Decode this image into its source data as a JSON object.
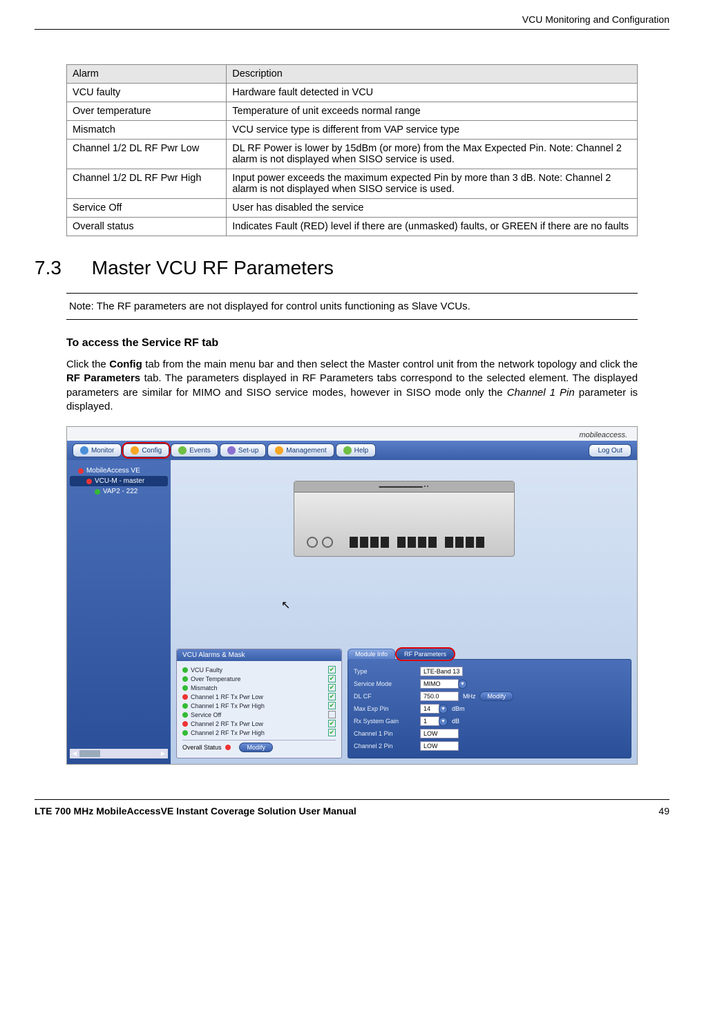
{
  "header": {
    "title": "VCU Monitoring and Configuration"
  },
  "alarm_table": {
    "headers": [
      "Alarm",
      "Description"
    ],
    "rows": [
      [
        "VCU faulty",
        "Hardware fault detected in VCU"
      ],
      [
        "Over temperature",
        "Temperature of unit exceeds normal range"
      ],
      [
        "Mismatch",
        "VCU service type is different from VAP service type"
      ],
      [
        "Channel 1/2 DL RF Pwr Low",
        "DL RF Power is lower by 15dBm (or more) from the Max Expected Pin. Note: Channel 2 alarm is not displayed when SISO service is used."
      ],
      [
        "Channel 1/2 DL RF Pwr High",
        "Input power exceeds the maximum expected Pin by more than 3 dB. Note: Channel 2 alarm is not displayed when SISO service is used."
      ],
      [
        "Service Off",
        "User has disabled the service"
      ],
      [
        "Overall status",
        "Indicates Fault (RED) level if there are (unmasked) faults, or GREEN if there are no faults"
      ]
    ]
  },
  "section": {
    "number": "7.3",
    "title": "Master VCU RF Parameters"
  },
  "note": "Note: The RF parameters are not displayed for control units functioning as Slave VCUs.",
  "subheading": "To access the Service RF tab",
  "para": {
    "t1": "Click the ",
    "b1": "Config",
    "t2": " tab from the main menu bar and then select the Master control unit from the network topology and click the ",
    "b2": "RF Parameters",
    "t3": " tab. The parameters displayed in RF Parameters tabs correspond to the selected element. The displayed parameters are similar for MIMO and SISO service modes, however in SISO mode only the ",
    "i1": "Channel 1 Pin",
    "t4": " parameter is displayed."
  },
  "app": {
    "logo": "mobileaccess.",
    "menu": {
      "items": [
        "Monitor",
        "Config",
        "Events",
        "Set-up",
        "Management",
        "Help"
      ],
      "logout": "Log Out"
    },
    "tree": {
      "root": "MobileAccess VE",
      "items": [
        {
          "label": "VCU-M - master",
          "status": "red",
          "level": 2
        },
        {
          "label": "VAP2 - 222",
          "status": "green",
          "level": 3
        }
      ]
    },
    "alarms_panel": {
      "title": "VCU Alarms & Mask",
      "items": [
        {
          "label": "VCU Faulty",
          "status": "green",
          "checked": true
        },
        {
          "label": "Over Temperature",
          "status": "green",
          "checked": true
        },
        {
          "label": "Mismatch",
          "status": "green",
          "checked": true
        },
        {
          "label": "Channel 1 RF Tx Pwr Low",
          "status": "red",
          "checked": true
        },
        {
          "label": "Channel 1 RF Tx Pwr High",
          "status": "green",
          "checked": true
        },
        {
          "label": "Service Off",
          "status": "green",
          "checked": false
        },
        {
          "label": "Channel 2 RF Tx Pwr Low",
          "status": "red",
          "checked": true
        },
        {
          "label": "Channel 2 RF Tx Pwr High",
          "status": "green",
          "checked": true
        }
      ],
      "overall_label": "Overall Status",
      "overall_status": "red",
      "modify": "Modify"
    },
    "subtabs": [
      "Module Info",
      "RF Parameters"
    ],
    "rf_params": {
      "rows": [
        {
          "label": "Type",
          "value": "LTE-Band 13",
          "dropdown": false,
          "unit": ""
        },
        {
          "label": "Service Mode",
          "value": "MIMO",
          "dropdown": true,
          "unit": ""
        },
        {
          "label": "DL CF",
          "value": "750.0",
          "dropdown": false,
          "unit": "MHz",
          "modify": true
        },
        {
          "label": "Max Exp Pin",
          "value": "14",
          "dropdown": true,
          "unit": "dBm"
        },
        {
          "label": "Rx System Gain",
          "value": "1",
          "dropdown": true,
          "unit": "dB"
        },
        {
          "label": "Channel 1 Pin",
          "value": "LOW",
          "dropdown": false,
          "unit": ""
        },
        {
          "label": "Channel 2 Pin",
          "value": "LOW",
          "dropdown": false,
          "unit": ""
        }
      ],
      "modify": "Modify"
    }
  },
  "footer": {
    "title": "LTE 700 MHz MobileAccessVE Instant Coverage Solution User Manual",
    "page": "49"
  }
}
